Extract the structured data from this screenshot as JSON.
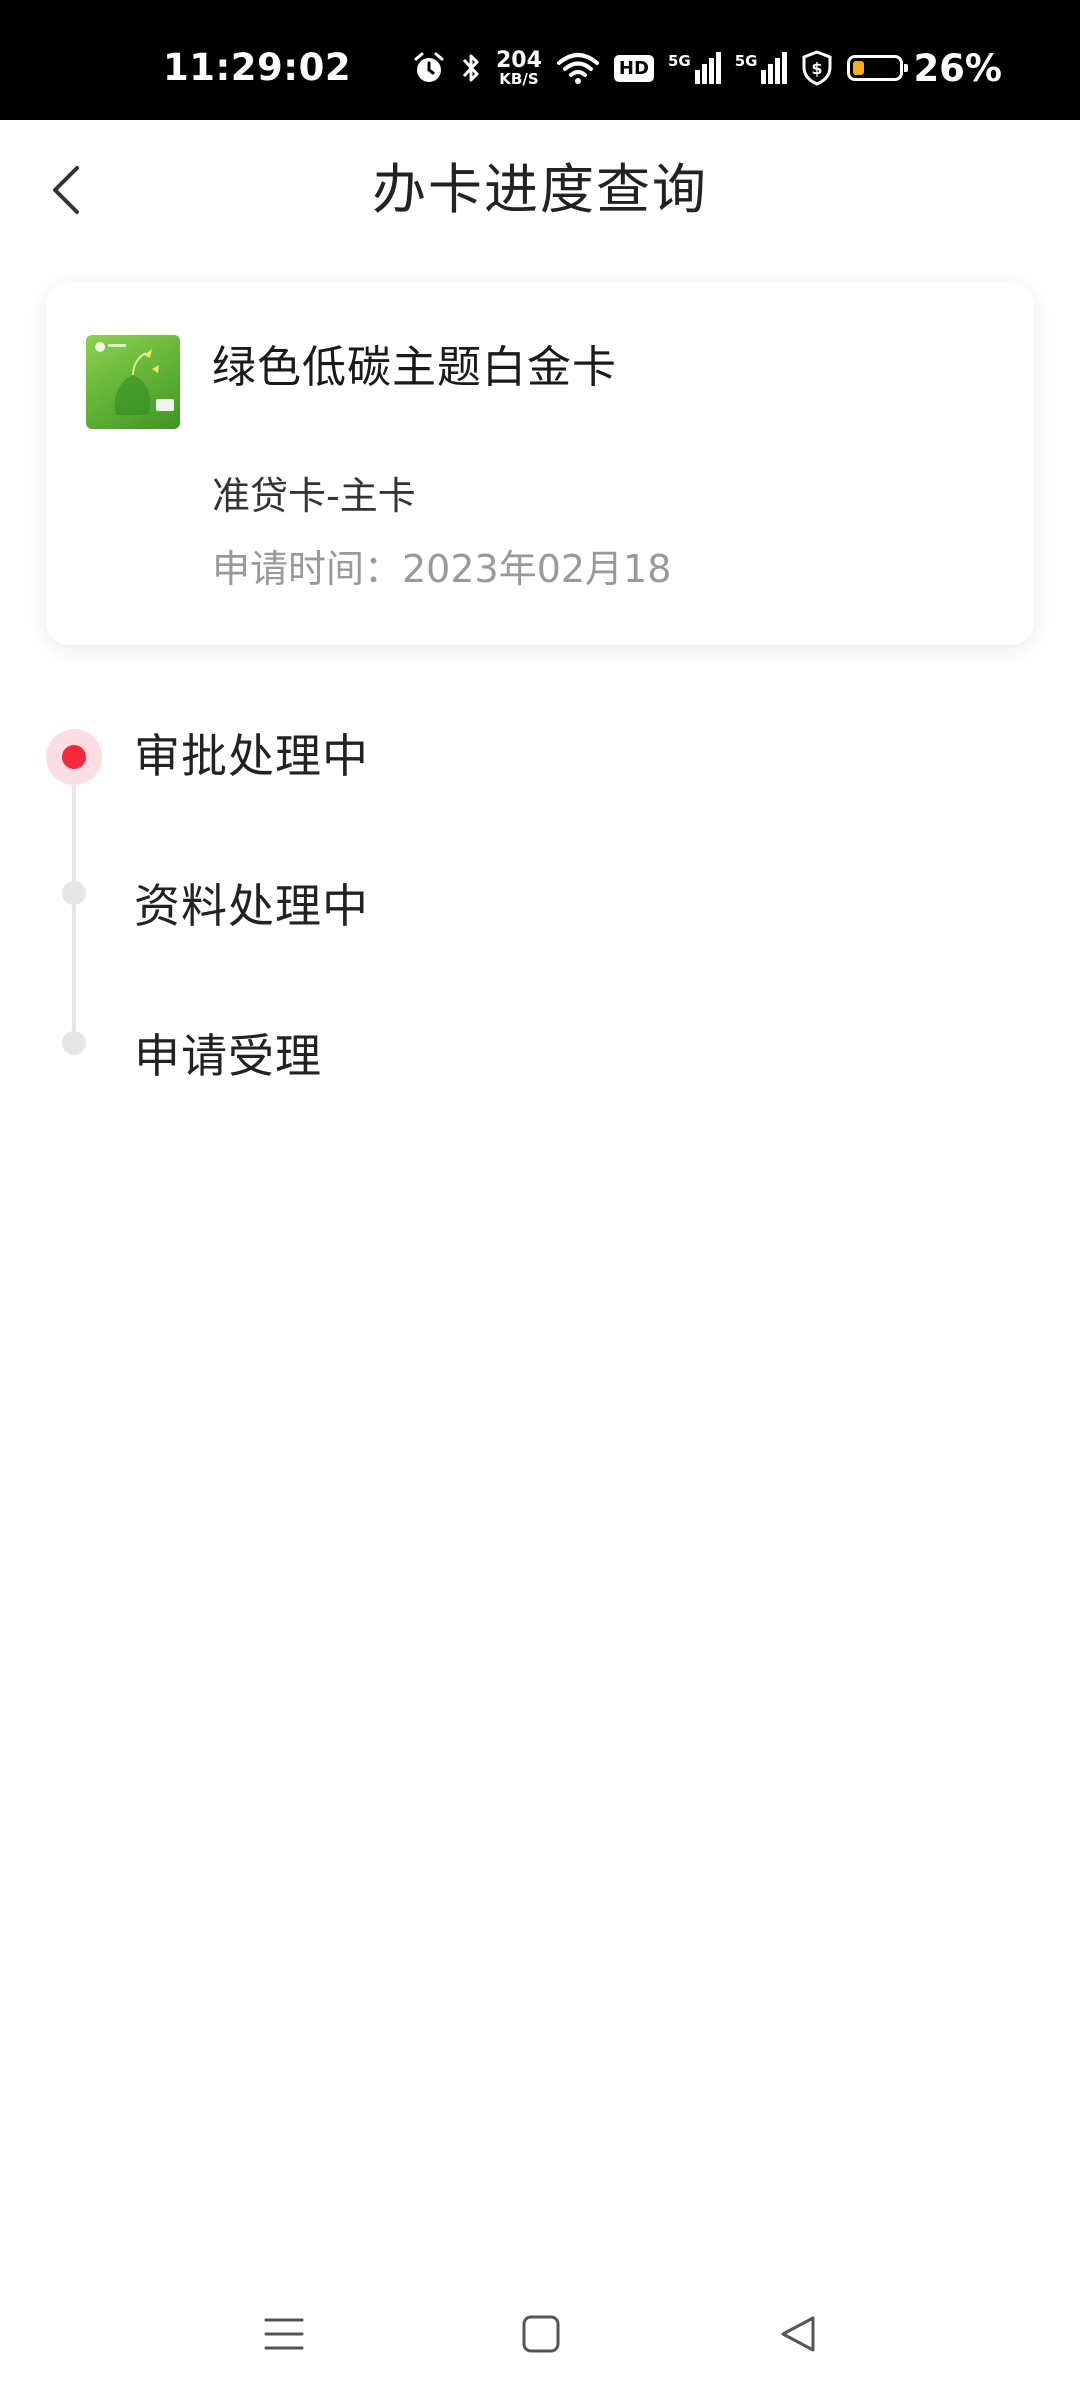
{
  "status_bar": {
    "time": "11:29:02",
    "net_speed_value": "204",
    "net_speed_unit": "KB/S",
    "hd_label": "HD",
    "network_1": "5G",
    "network_2": "5G",
    "battery_percent": "26%",
    "battery_level": 0.26,
    "battery_color": "#f2b01e"
  },
  "header": {
    "title": "办卡进度查询",
    "back_icon": "chevron-left-icon"
  },
  "card": {
    "name": "绿色低碳主题白金卡",
    "type": "准贷卡-主卡",
    "apply_time": "申请时间：2023年02月18"
  },
  "timeline": {
    "active_color": "#f5293e",
    "steps": [
      {
        "label": "审批处理中",
        "active": true
      },
      {
        "label": "资料处理中",
        "active": false
      },
      {
        "label": "申请受理",
        "active": false
      }
    ]
  },
  "nav_bar": {
    "icons": [
      "menu-icon",
      "home-square-icon",
      "back-triangle-icon"
    ]
  }
}
